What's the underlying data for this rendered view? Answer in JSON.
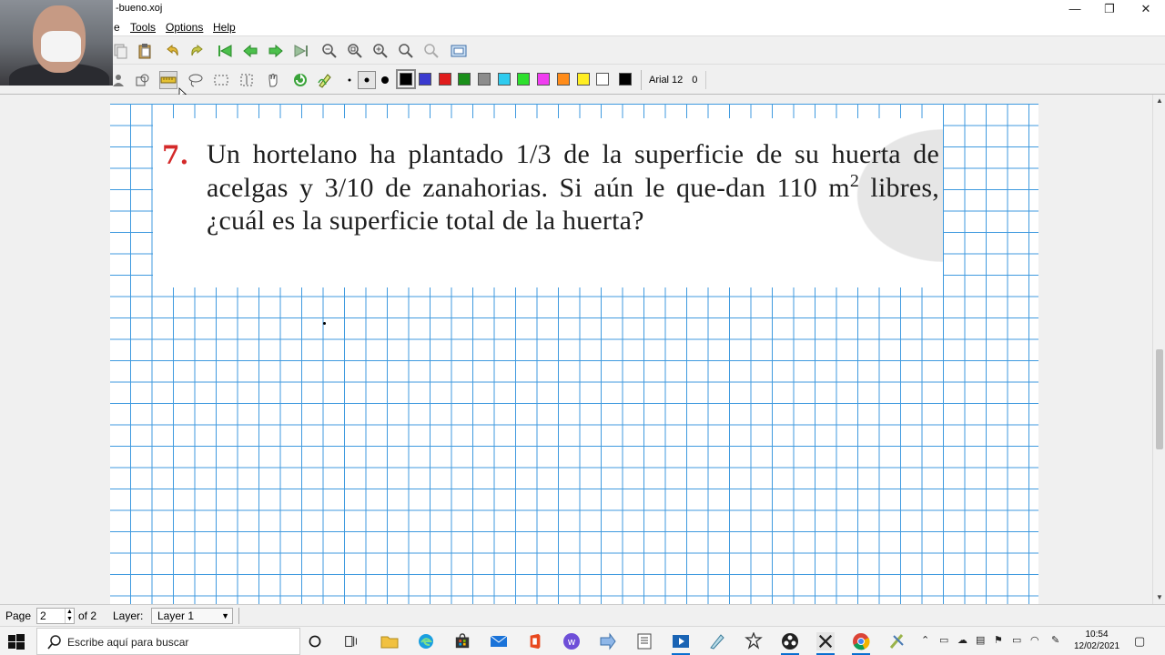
{
  "window": {
    "title": "-bueno.xoj",
    "minimize": "—",
    "restore": "❐",
    "close": "✕"
  },
  "menu": {
    "items": [
      "e",
      "Tools",
      "Options",
      "Help"
    ]
  },
  "toolbar": {
    "colors": [
      "#000000",
      "#3a3acf",
      "#e01c1c",
      "#1a8f1a",
      "#8c8c8c",
      "#2ecbef",
      "#2ee02e",
      "#f03cf0",
      "#ff8c1a",
      "#ffee22",
      "#ffffff",
      "#000000"
    ],
    "selected_color_index": 0,
    "font_label": "Arial 12",
    "font_extra": "0"
  },
  "document": {
    "problem_number": "7.",
    "problem_text_before_sup": "Un hortelano ha plantado 1/3 de la superficie de su huerta de acelgas y 3/10 de zanahorias. Si aún le que-dan 110 m",
    "problem_sup": "2",
    "problem_text_after_sup": " libres, ¿cuál es la superficie total de la huerta?",
    "grid_color": "#3f9adf"
  },
  "status": {
    "page_label": "Page",
    "page_value": "2",
    "page_of": "of 2",
    "layer_label": "Layer:",
    "layer_value": "Layer 1"
  },
  "taskbar": {
    "search_placeholder": "Escribe aquí para buscar",
    "time": "10:54",
    "date": "12/02/2021"
  }
}
